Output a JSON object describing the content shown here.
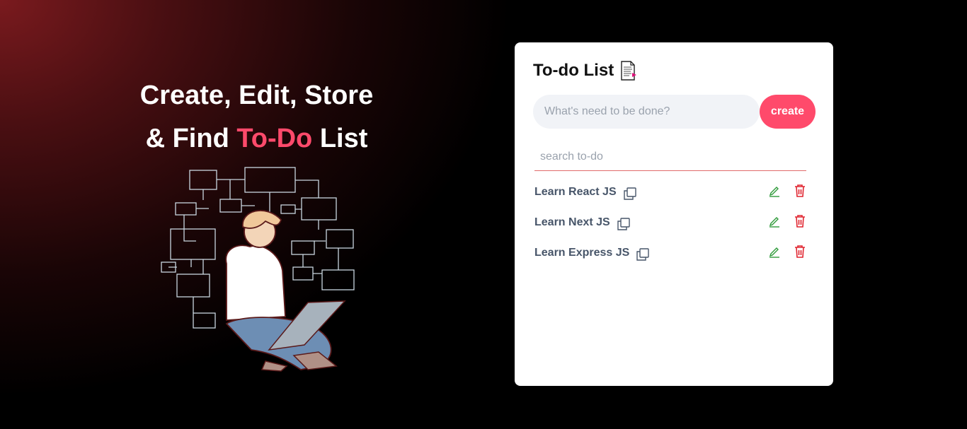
{
  "hero": {
    "line1": "Create, Edit, Store",
    "line2_prefix": "& Find ",
    "line2_accent": "To-Do",
    "line2_suffix": " List"
  },
  "card": {
    "title": "To-do List",
    "title_icon": "document-icon",
    "create_placeholder": "What's need to be done?",
    "create_button": "create",
    "search_placeholder": "search to-do"
  },
  "todos": [
    {
      "text": "Learn React JS"
    },
    {
      "text": "Learn Next JS"
    },
    {
      "text": "Learn Express JS"
    }
  ],
  "colors": {
    "accent": "#ff4a6b",
    "edit": "#2f9a3a",
    "delete": "#e0242f",
    "text": "#475569"
  }
}
